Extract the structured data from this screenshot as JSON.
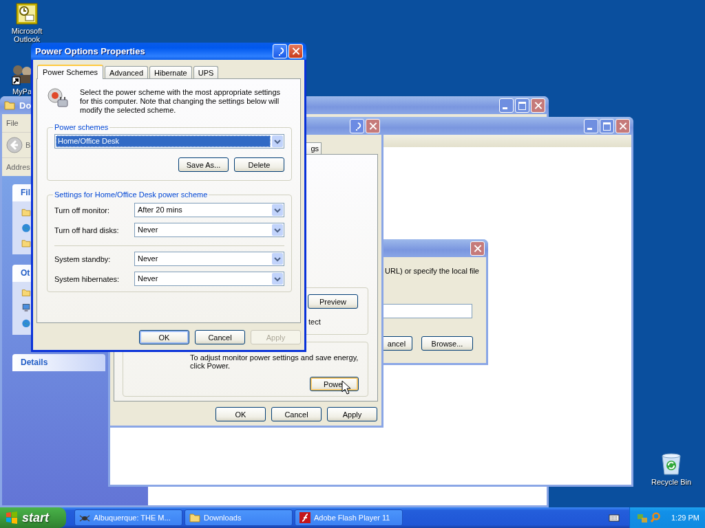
{
  "desktop_icons": [
    {
      "kind": "outlook",
      "label": "Microsoft Outlook"
    },
    {
      "kind": "mypa",
      "label": "MyPa"
    },
    {
      "kind": "recycle",
      "label": "Recycle Bin"
    }
  ],
  "downloads_window": {
    "title": "Do",
    "menu": [
      "File"
    ],
    "back_label": "B",
    "address_label": "Addres",
    "task_panels": [
      {
        "title": "Fil"
      },
      {
        "title": "Ot"
      },
      {
        "title": "Details"
      }
    ]
  },
  "display_dialog": {
    "tab_label": "gs",
    "preview_button": "Preview",
    "text_fragment": "tect",
    "power_note": "To adjust monitor power settings and save energy, click Power.",
    "power_button": "Power",
    "buttons": [
      "OK",
      "Cancel",
      "Apply"
    ]
  },
  "url_dialog": {
    "text": "URL) or specify the local file",
    "cancel_button": "ancel",
    "browse_button": "Browse..."
  },
  "power_options": {
    "title": "Power Options Properties",
    "tabs": [
      {
        "label": "Power Schemes",
        "selected": true
      },
      {
        "label": "Advanced",
        "selected": false
      },
      {
        "label": "Hibernate",
        "selected": false
      },
      {
        "label": "UPS",
        "selected": false
      }
    ],
    "intro": "Select the power scheme with the most appropriate settings for this computer. Note that changing the settings below will modify the selected scheme.",
    "schemes_group": "Power schemes",
    "scheme": "Home/Office Desk",
    "scheme_buttons": [
      "Save As...",
      "Delete"
    ],
    "settings_group": "Settings for Home/Office Desk power scheme",
    "settings_sections": [
      [
        {
          "label": "Turn off monitor:",
          "value": "After 20 mins"
        },
        {
          "label": "Turn off hard disks:",
          "value": "Never"
        }
      ],
      [
        {
          "label": "System standby:",
          "value": "Never"
        },
        {
          "label": "System hibernates:",
          "value": "Never"
        }
      ]
    ],
    "buttons": [
      {
        "label": "OK",
        "default": true,
        "disabled": false
      },
      {
        "label": "Cancel",
        "default": false,
        "disabled": false
      },
      {
        "label": "Apply",
        "default": false,
        "disabled": true
      }
    ]
  },
  "taskbar": {
    "start_label": "start",
    "tasks": [
      {
        "kind": "browser",
        "label": "Albuquerque: THE M..."
      },
      {
        "kind": "folder",
        "label": "Downloads"
      },
      {
        "kind": "flash",
        "label": "Adobe Flash Player 11"
      }
    ],
    "clock": "1:29 PM"
  }
}
